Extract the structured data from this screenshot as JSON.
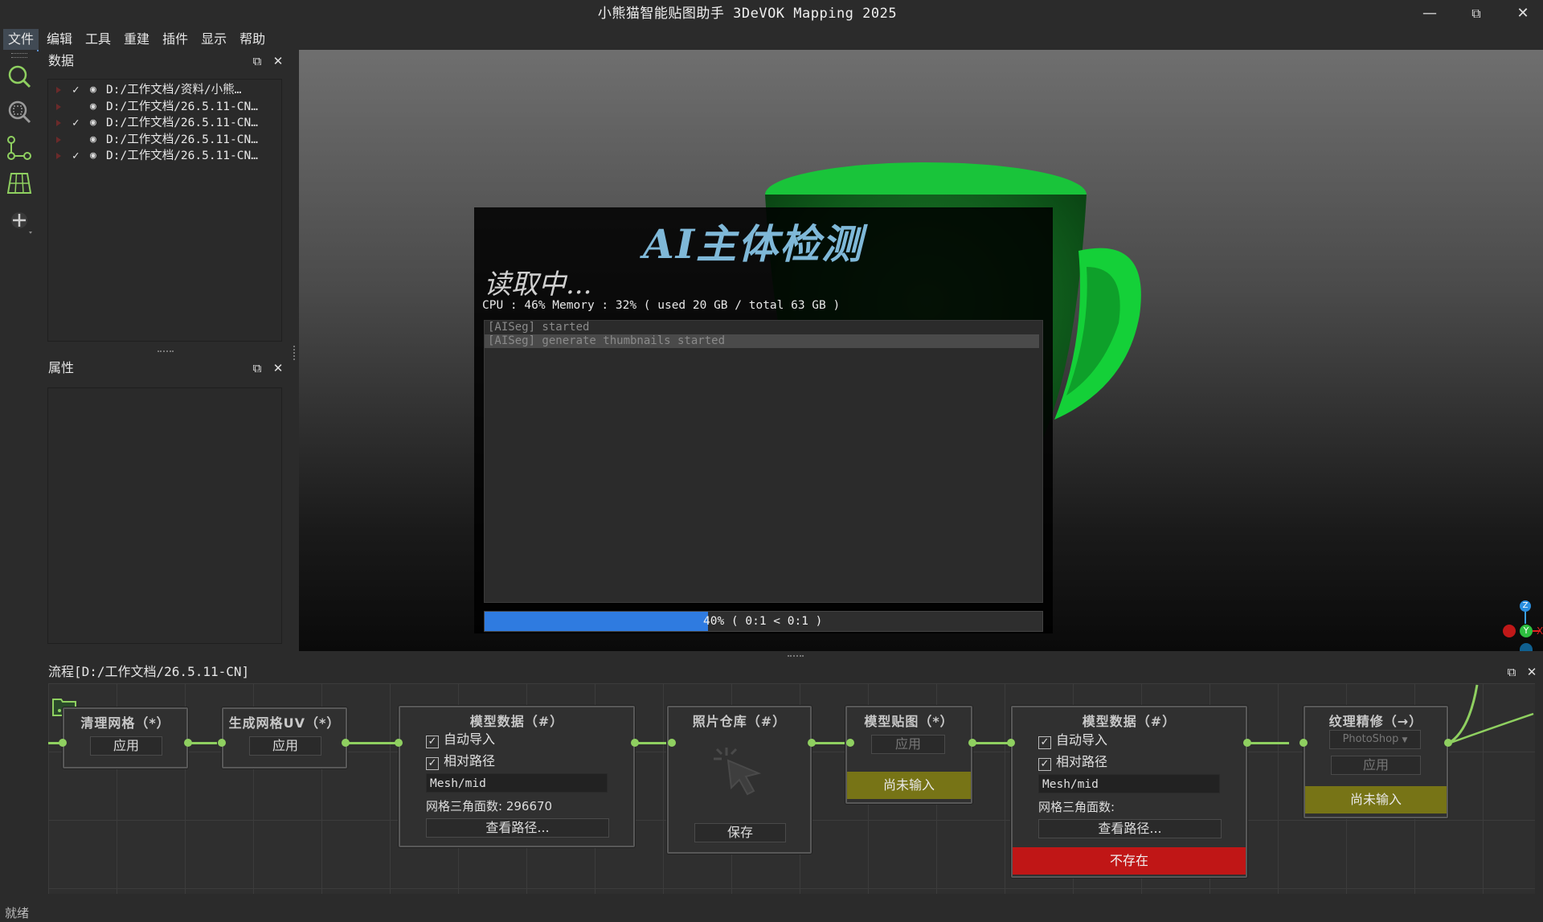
{
  "window": {
    "title": "小熊猫智能贴图助手 3DeVOK Mapping 2025",
    "minimize_glyph": "—",
    "restore_glyph": "⧉",
    "close_glyph": "✕"
  },
  "menu": [
    "文件",
    "编辑",
    "工具",
    "重建",
    "插件",
    "显示",
    "帮助"
  ],
  "toolbar": {
    "icons": [
      "search-icon",
      "zoom-fit-icon",
      "nodes-icon",
      "grid-plane-icon",
      "move-icon"
    ]
  },
  "data_panel": {
    "title": "数据",
    "items": [
      {
        "checked": "✓",
        "path": "D:/工作文档/资料/小熊…"
      },
      {
        "checked": "",
        "path": "D:/工作文档/26.5.11-CN…"
      },
      {
        "checked": "✓",
        "path": "D:/工作文档/26.5.11-CN…"
      },
      {
        "checked": "",
        "path": "D:/工作文档/26.5.11-CN…"
      },
      {
        "checked": "✓",
        "path": "D:/工作文档/26.5.11-CN…"
      }
    ]
  },
  "props_panel": {
    "title": "属性"
  },
  "dialog": {
    "title": "AI主体检测",
    "status": "读取中...",
    "cpu_line": "CPU : 46%  Memory : 32% ( used 20 GB / total 63 GB )",
    "log": [
      "[AISeg] started",
      "[AISeg] generate thumbnails started"
    ],
    "progress": 0.4,
    "progress_text": "40% ( 0:1 < 0:1 )"
  },
  "axis_gizmo": {
    "z": "Z",
    "y": "Y",
    "x": "X"
  },
  "flow": {
    "title": "流程[D:/工作文档/26.5.11-CN]",
    "nodes": {
      "clean": {
        "title": "清理网格（*）",
        "apply": "应用"
      },
      "uv": {
        "title": "生成网格UV（*）",
        "apply": "应用"
      },
      "model1": {
        "title": "模型数据（#）",
        "auto_import": "自动导入",
        "relative_path": "相对路径",
        "mesh": "Mesh/mid",
        "triangles": "网格三角面数: 296670",
        "view_path": "查看路径..."
      },
      "photos": {
        "title": "照片仓库（#）",
        "save": "保存"
      },
      "texture": {
        "title": "模型贴图（*）",
        "apply": "应用",
        "status": "尚未输入"
      },
      "model2": {
        "title": "模型数据（#）",
        "auto_import": "自动导入",
        "relative_path": "相对路径",
        "mesh": "Mesh/mid",
        "triangles": "网格三角面数:",
        "view_path": "查看路径...",
        "status": "不存在"
      },
      "refine": {
        "title": "纹理精修（→）",
        "tool": "PhotoShop",
        "apply": "应用",
        "status": "尚未输入"
      }
    }
  },
  "statusbar": {
    "text": "就绪"
  },
  "colors": {
    "accent_green": "#8fd060",
    "progress_blue": "#2f7be0",
    "warn_yellow": "#777416",
    "error_red": "#c01616"
  }
}
